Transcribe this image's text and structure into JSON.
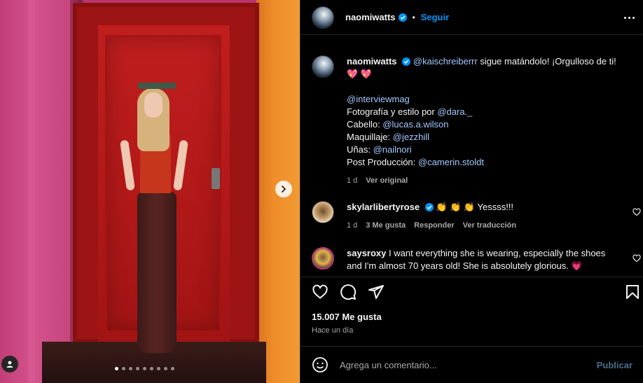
{
  "colors": {
    "accent": "#0095f6",
    "muted": "#a8a8a8",
    "mention": "#a4c8ff",
    "heart": "#ff3a7a",
    "bg": "#000000"
  },
  "media": {
    "total_slides": 9,
    "active_slide": 1,
    "next_icon": "chevron-right-icon",
    "tag_icon": "user-tag-icon"
  },
  "header": {
    "username": "naomiwatts",
    "bullet": "•",
    "follow_label": "Seguir",
    "more_icon": "more-horizontal-icon"
  },
  "caption": {
    "username": "naomiwatts",
    "mention_main": "@kaischreiberrr",
    "text_main": " sigue matándolo! ¡Orgulloso de ti!",
    "hearts": "💖 💖",
    "line_mag": "@interviewmag",
    "photo_label": "Fotografía y estilo por ",
    "photo_mention": "@dara._",
    "hair_label": "Cabello: ",
    "hair_mention": "@lucas.a.wilson",
    "makeup_label": "Maquillaje: ",
    "makeup_mention": "@jezzhill",
    "nails_label": "Uñas: ",
    "nails_mention": "@nailnori",
    "post_label": "Post Producción: ",
    "post_mention": "@camerin.stoldt",
    "time": "1 d",
    "see_original": "Ver original"
  },
  "comments": [
    {
      "username": "skylarlibertyrose",
      "text": " 👏 👏 👏 Yessss!!!",
      "time": "1 d",
      "likes": "3 Me gusta",
      "reply": "Responder",
      "translate": "Ver traducción"
    },
    {
      "username": "saysroxy",
      "text": " I want everything she is wearing, especially the shoes and I'm almost 70 years old! She is absolutely glorious. 💗"
    }
  ],
  "actions": {
    "like_icon": "heart-icon",
    "comment_icon": "comment-icon",
    "share_icon": "send-icon",
    "save_icon": "bookmark-icon"
  },
  "likes_count": "15.007 Me gusta",
  "posted_time": "Hace un día",
  "compose": {
    "placeholder": "Agrega un comentario...",
    "publish_label": "Publicar",
    "emoji_icon": "smile-icon"
  }
}
